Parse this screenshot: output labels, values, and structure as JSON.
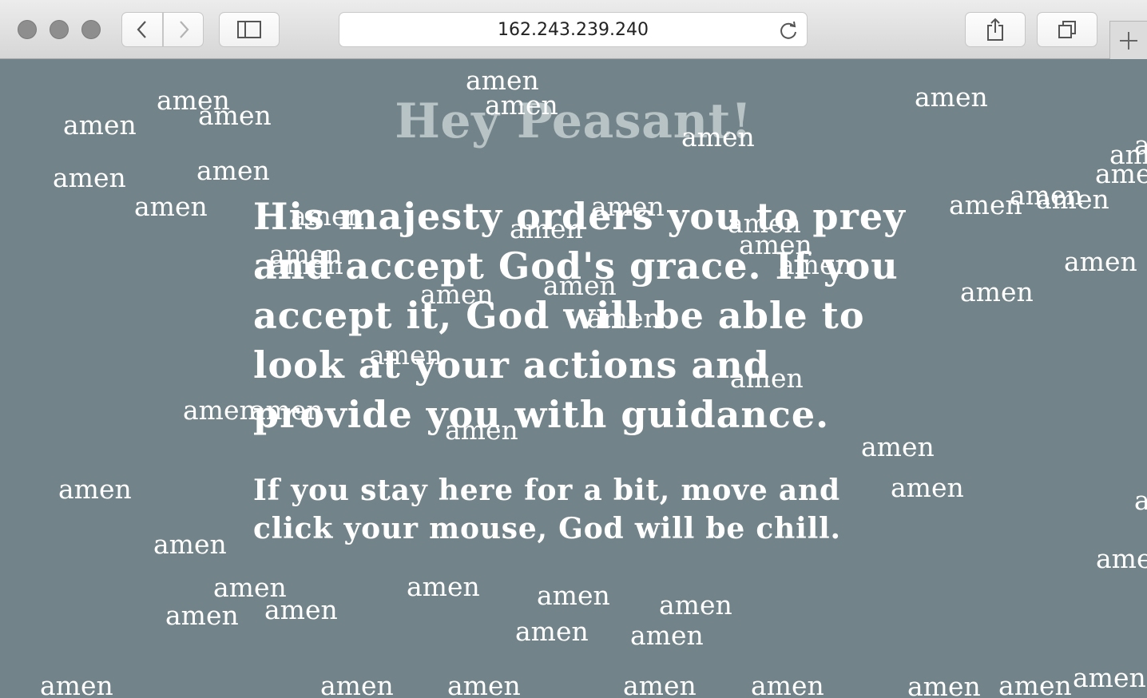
{
  "browser": {
    "url": "162.243.239.240",
    "icons": {
      "back": "chevron-left-icon",
      "forward": "chevron-right-icon",
      "sidebar": "sidebar-icon",
      "reload": "reload-icon",
      "share": "share-icon",
      "tabs": "tabs-overview-icon",
      "new_tab": "plus-icon"
    }
  },
  "page": {
    "title": "Hey Peasant!",
    "message": "His majesty orders you to prey and accept God's grace. If you accept it, God will be able to look at your actions and provide you with guidance.",
    "instructions": "If you stay here for a bit, move and click your mouse, God will be chill.",
    "background_color": "#728489",
    "title_color": "#b8c3c6"
  },
  "amen_word": "amen",
  "amen_count": 56
}
